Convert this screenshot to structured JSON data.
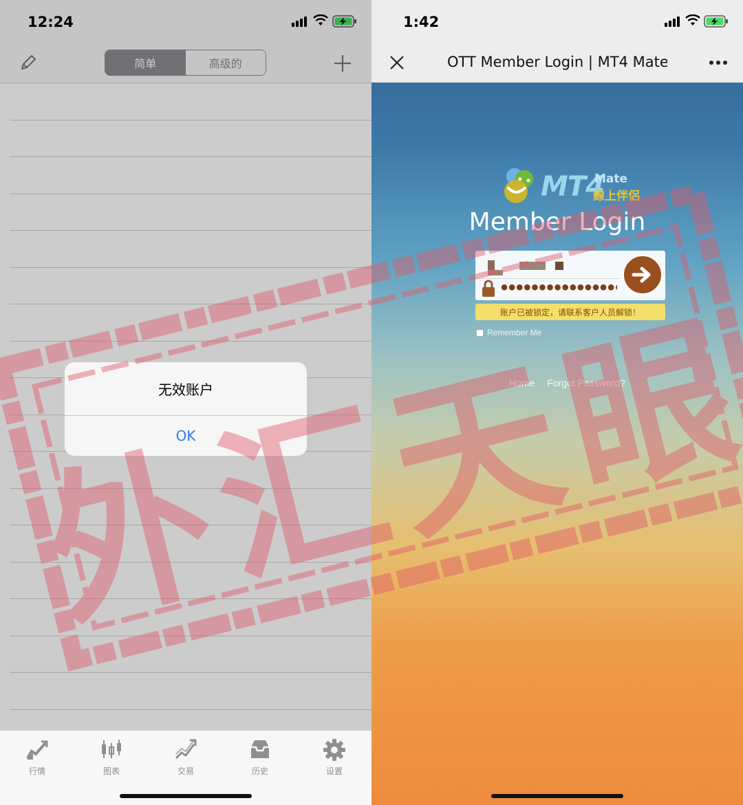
{
  "left": {
    "status_time": "12:24",
    "segment": [
      "简单",
      "高级的"
    ],
    "alert": {
      "title": "无效账户",
      "button": "OK"
    },
    "tabs": [
      {
        "label": "行情",
        "icon": "quotes-icon"
      },
      {
        "label": "图表",
        "icon": "chart-icon"
      },
      {
        "label": "交易",
        "icon": "trade-icon"
      },
      {
        "label": "历史",
        "icon": "history-icon"
      },
      {
        "label": "设置",
        "icon": "settings-icon"
      }
    ]
  },
  "right": {
    "status_time": "1:42",
    "page_title": "OTT Member Login | MT4 Mate",
    "logo": {
      "mt4": "MT4",
      "mate": "Mate",
      "cn": "線上伴侶"
    },
    "heading": "Member Login",
    "password_dots": "●●●●●●●●●●●●●●●●",
    "error_message": "账户已被锁定，请联系客户人员解锁！",
    "remember_label": "Remember Me",
    "links": {
      "home": "Home",
      "forgot": "Forgot Password?"
    }
  },
  "watermark": "外汇天眼",
  "colors": {
    "ios_blue": "#2f7ae5",
    "go_button": "#9a4f1e",
    "error_bg": "#f2e06b",
    "watermark": "#e05a6a"
  }
}
